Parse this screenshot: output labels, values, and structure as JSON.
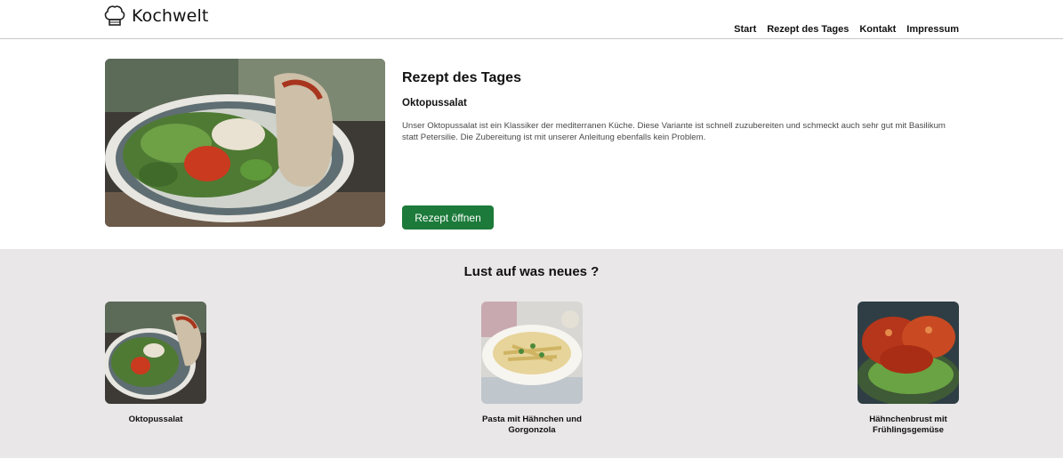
{
  "header": {
    "logo_text": "Kochwelt",
    "logo_icon": "chef-hat-icon",
    "nav": [
      "Start",
      "Rezept des Tages",
      "Kontakt",
      "Impressum"
    ]
  },
  "hero": {
    "title": "Rezept des Tages",
    "recipe_name": "Oktopussalat",
    "description": "Unser Oktopussalat ist ein Klassiker der mediterranen Küche. Diese Variante ist schnell zuzubereiten und schmeckt auch sehr gut mit Basilikum statt Petersilie. Die Zubereitung ist mit unserer Anleitung ebenfalls kein Problem.",
    "button_label": "Rezept öffnen"
  },
  "suggestions": {
    "title": "Lust auf was neues ?",
    "cards": [
      {
        "label": "Oktopussalat"
      },
      {
        "label": "Pasta mit Hähnchen und Gorgonzola"
      },
      {
        "label": "Hähnchenbrust mit Frühlingsgemüse"
      }
    ]
  },
  "colors": {
    "accent_button": "#1c7a3a",
    "section_background": "#e9e7e8"
  }
}
